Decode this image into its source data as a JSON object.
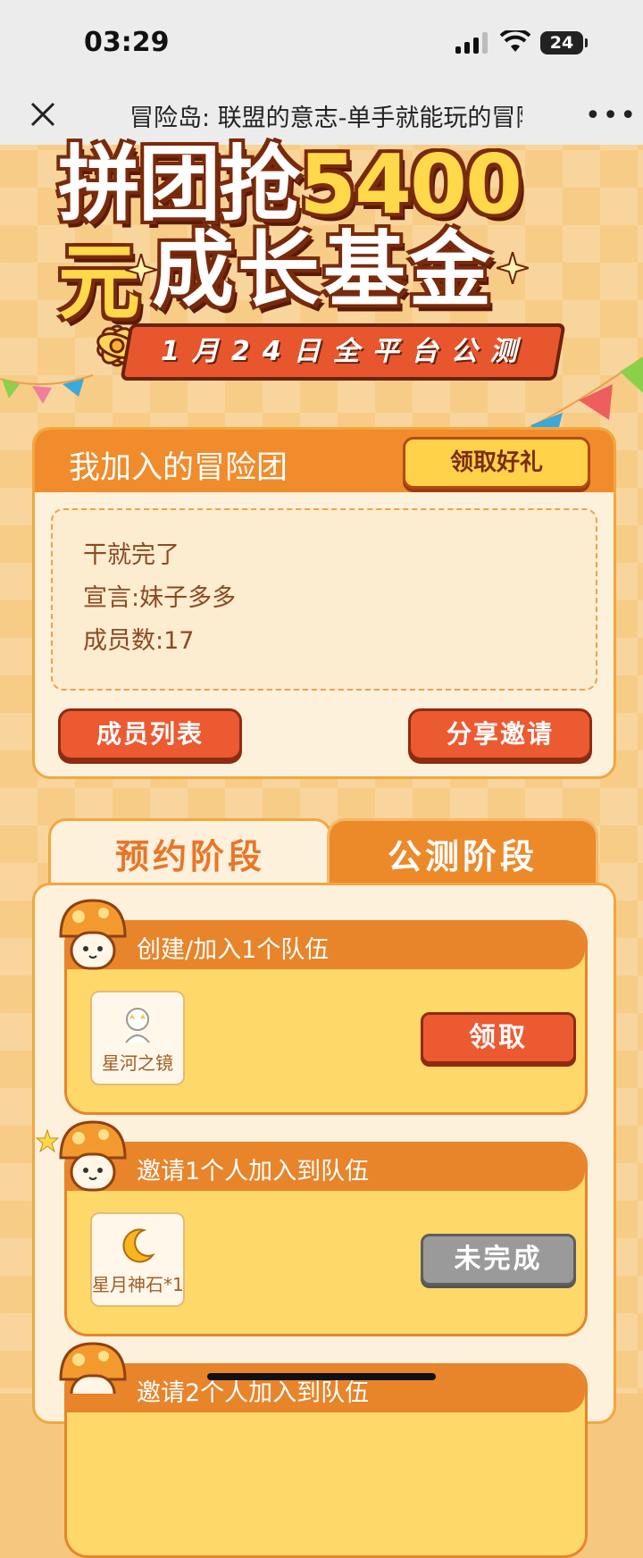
{
  "status_bar": {
    "time": "03:29",
    "battery": "24"
  },
  "title_bar": {
    "title": "冒险岛: 联盟的意志-单手就能玩的冒险岛"
  },
  "banner": {
    "line1_prefix": "拼团抢",
    "line1_amount": "5400元",
    "line2": "成长基金",
    "ribbon": "1月24日全平台公测"
  },
  "team": {
    "header": "我加入的冒险团",
    "gift_button": "领取好礼",
    "name": "干就完了",
    "declaration": "宣言:妹子多多",
    "members": "成员数:17",
    "member_list_button": "成员列表",
    "share_button": "分享邀请"
  },
  "tabs": [
    {
      "label": "预约阶段",
      "active": true
    },
    {
      "label": "公测阶段",
      "active": false
    }
  ],
  "tasks": [
    {
      "title": "创建/加入1个队伍",
      "reward": "星河之镜",
      "reward_icon": "mirror-icon",
      "button": "领取",
      "state": "claimable"
    },
    {
      "title": "邀请1个人加入到队伍",
      "reward": "星月神石*1",
      "reward_icon": "crescent-moon-icon",
      "button": "未完成",
      "state": "incomplete"
    },
    {
      "title": "邀请2个人加入到队伍"
    }
  ],
  "colors": {
    "accent": "#f08c2c",
    "button_red": "#ec5a32",
    "card_bg": "#fdf1dc",
    "task_bg": "#ffd86a"
  }
}
